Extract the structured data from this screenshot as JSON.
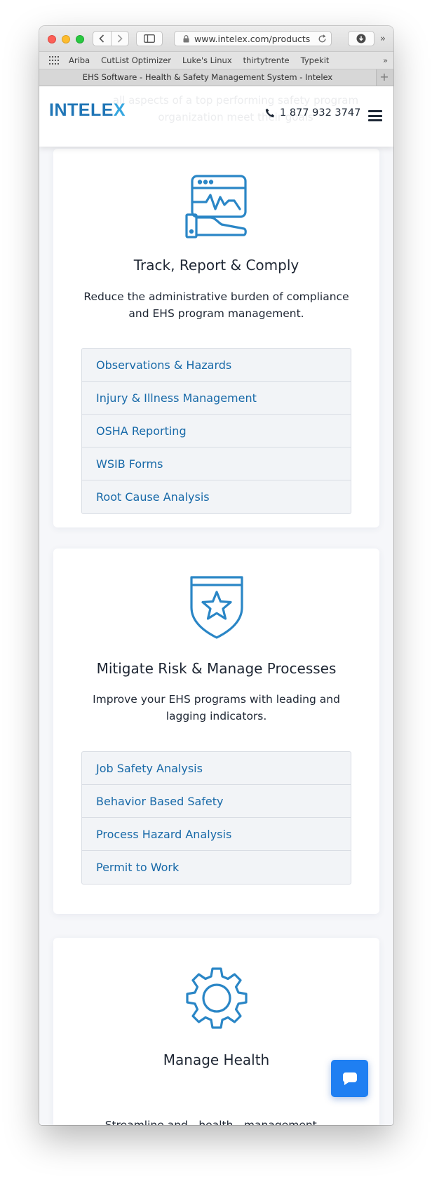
{
  "browser": {
    "url": "www.intelex.com/products",
    "tab_title": "EHS Software - Health & Safety Management System - Intelex",
    "bookmarks": [
      "Ariba",
      "CutList Optimizer",
      "Luke's Linux",
      "thirtytrente",
      "Typekit"
    ],
    "more_glyph": "»",
    "new_tab_glyph": "+"
  },
  "header": {
    "logo_main": "INTELE",
    "logo_accent": "X",
    "phone": "1 877 932 3747",
    "background_text": "all aspects of a top performing safety program organization meet their goals"
  },
  "cards": [
    {
      "icon": "monitor-hand-icon",
      "title": "Track, Report & Comply",
      "description": "Reduce the administrative burden of compliance and EHS program management.",
      "links": [
        "Observations & Hazards",
        "Injury & Illness Management",
        "OSHA Reporting",
        "WSIB Forms",
        "Root Cause Analysis"
      ]
    },
    {
      "icon": "shield-star-icon",
      "title": "Mitigate Risk & Manage Processes",
      "description": "Improve your EHS programs with leading and lagging indicators.",
      "links": [
        "Job Safety Analysis",
        "Behavior Based Safety",
        "Process Hazard Analysis",
        "Permit to Work"
      ]
    },
    {
      "icon": "gear-icon",
      "title": "Manage Health",
      "description_partial": "Streamline and…health…management…"
    }
  ],
  "colors": {
    "brand_blue": "#1f75b6",
    "link_blue": "#1769a8",
    "chat_blue": "#1f7ff2",
    "icon_blue": "#2a86c6"
  }
}
